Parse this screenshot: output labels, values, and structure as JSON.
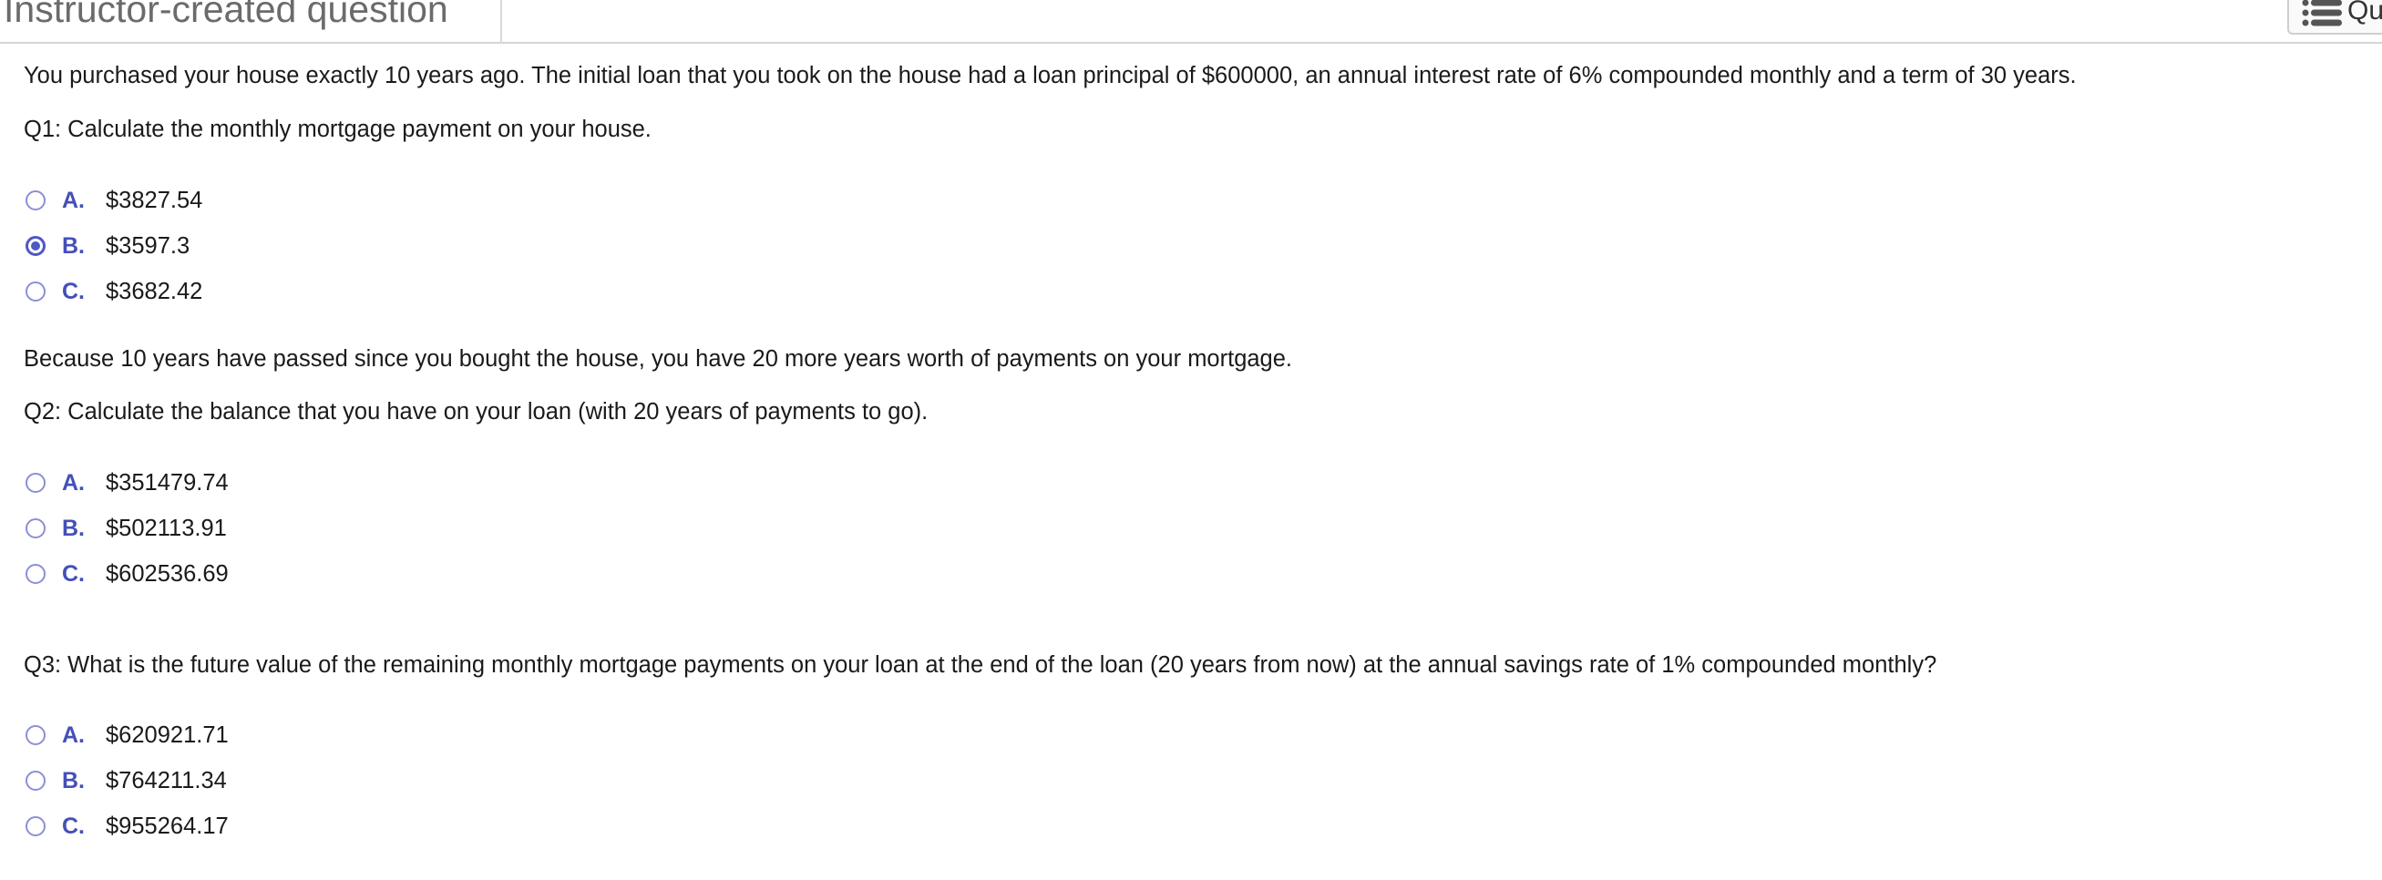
{
  "header": {
    "title": "Instructor-created question",
    "button_label": "Qu",
    "button_icon": "list-icon"
  },
  "problem": {
    "intro": "You purchased your house exactly 10 years ago. The initial loan that you took on the house had a loan principal of $600000, an annual interest rate of 6% compounded monthly and a term of 30 years.",
    "q1": {
      "text": "Q1: Calculate the monthly mortgage payment on your house.",
      "options": [
        {
          "letter": "A.",
          "value": "$3827.54",
          "selected": false
        },
        {
          "letter": "B.",
          "value": "$3597.3",
          "selected": true
        },
        {
          "letter": "C.",
          "value": "$3682.42",
          "selected": false
        }
      ]
    },
    "middle": "Because 10 years have passed since you bought the house, you have 20 more years worth of payments on your mortgage.",
    "q2": {
      "text": "Q2: Calculate the balance that you have on your loan (with 20 years of payments to go).",
      "options": [
        {
          "letter": "A.",
          "value": "$351479.74",
          "selected": false
        },
        {
          "letter": "B.",
          "value": "$502113.91",
          "selected": false
        },
        {
          "letter": "C.",
          "value": "$602536.69",
          "selected": false
        }
      ]
    },
    "q3": {
      "text": "Q3: What is the future value of the remaining monthly mortgage payments on your loan at the end of the loan (20 years from now) at the annual savings rate of 1% compounded monthly?",
      "options": [
        {
          "letter": "A.",
          "value": "$620921.71",
          "selected": false
        },
        {
          "letter": "B.",
          "value": "$764211.34",
          "selected": false
        },
        {
          "letter": "C.",
          "value": "$955264.17",
          "selected": false
        }
      ]
    }
  },
  "colors": {
    "accent": "#4450b8",
    "radio_border": "#8c8fd6",
    "header_text": "#6b6b6b"
  }
}
